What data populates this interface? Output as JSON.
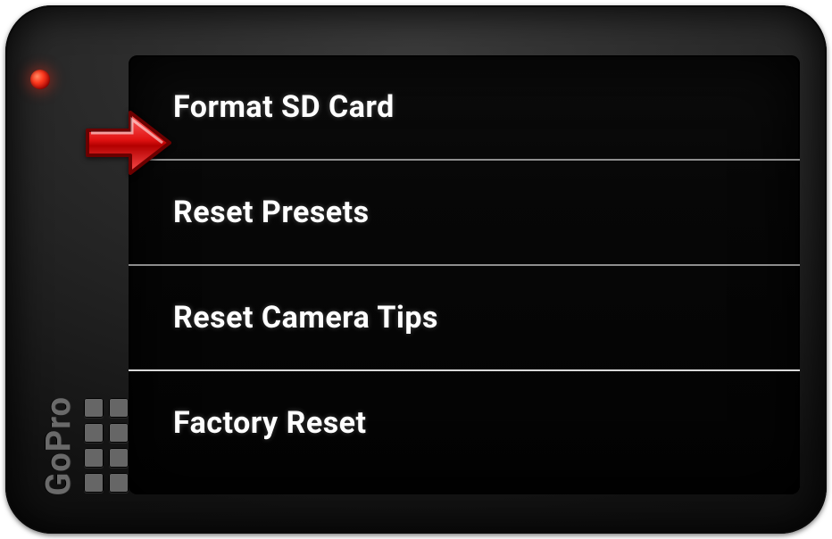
{
  "brand": "GoPro",
  "menu": {
    "items": [
      {
        "label": "Format SD Card"
      },
      {
        "label": "Reset Presets"
      },
      {
        "label": "Reset Camera Tips"
      },
      {
        "label": "Factory Reset"
      }
    ]
  }
}
